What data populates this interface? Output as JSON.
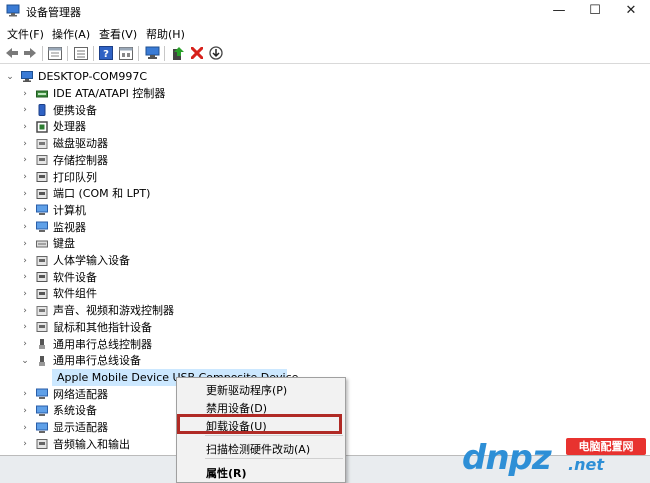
{
  "window": {
    "title": "设备管理器",
    "minimize_glyph": "—",
    "maximize_glyph": "☐",
    "close_glyph": "✕"
  },
  "menu": [
    {
      "label": "文件(F)"
    },
    {
      "label": "操作(A)"
    },
    {
      "label": "查看(V)"
    },
    {
      "label": "帮助(H)"
    }
  ],
  "toolbar": {
    "buttons": [
      {
        "icon": "back-arrow-icon"
      },
      {
        "icon": "forward-arrow-icon"
      },
      {
        "icon": "properties-icon"
      },
      {
        "icon": "list-view-icon"
      },
      {
        "icon": "help-icon"
      },
      {
        "icon": "resources-view-icon"
      },
      {
        "icon": "scan-hardware-icon"
      },
      {
        "icon": "update-driver-icon"
      },
      {
        "icon": "uninstall-icon"
      },
      {
        "icon": "download-arrow-icon"
      }
    ],
    "colors": {
      "uninstall": "#d7211b",
      "help": "#2f62c4",
      "update": "#2aa02a"
    }
  },
  "tree": {
    "root": {
      "label": "DESKTOP-COM997C",
      "expanded": true
    },
    "items": [
      {
        "label": "IDE ATA/ATAPI 控制器",
        "icon": "ide-controller-icon",
        "expanded": false
      },
      {
        "label": "便携设备",
        "icon": "portable-device-icon",
        "expanded": false
      },
      {
        "label": "处理器",
        "icon": "processor-icon",
        "expanded": false
      },
      {
        "label": "磁盘驱动器",
        "icon": "disk-drive-icon",
        "expanded": false
      },
      {
        "label": "存储控制器",
        "icon": "storage-controller-icon",
        "expanded": false
      },
      {
        "label": "打印队列",
        "icon": "printer-icon",
        "expanded": false
      },
      {
        "label": "端口 (COM 和 LPT)",
        "icon": "port-icon",
        "expanded": false
      },
      {
        "label": "计算机",
        "icon": "computer-icon",
        "expanded": false
      },
      {
        "label": "监视器",
        "icon": "monitor-icon",
        "expanded": false
      },
      {
        "label": "键盘",
        "icon": "keyboard-icon",
        "expanded": false
      },
      {
        "label": "人体学输入设备",
        "icon": "hid-icon",
        "expanded": false
      },
      {
        "label": "软件设备",
        "icon": "software-device-icon",
        "expanded": false
      },
      {
        "label": "软件组件",
        "icon": "software-component-icon",
        "expanded": false
      },
      {
        "label": "声音、视频和游戏控制器",
        "icon": "sound-icon",
        "expanded": false
      },
      {
        "label": "鼠标和其他指针设备",
        "icon": "mouse-icon",
        "expanded": false
      },
      {
        "label": "通用串行总线控制器",
        "icon": "usb-icon",
        "expanded": false
      },
      {
        "label": "通用串行总线设备",
        "icon": "usb-icon",
        "expanded": true
      },
      {
        "label": "Apple Mobile Device USB Composite Device",
        "icon": "usb-device-icon",
        "child": true,
        "selected": true
      },
      {
        "label": "网络适配器",
        "icon": "network-adapter-icon",
        "expanded": false
      },
      {
        "label": "系统设备",
        "icon": "system-device-icon",
        "expanded": false
      },
      {
        "label": "显示适配器",
        "icon": "display-adapter-icon",
        "expanded": false
      },
      {
        "label": "音频输入和输出",
        "icon": "audio-io-icon",
        "expanded": false
      }
    ]
  },
  "context_menu": {
    "items": [
      {
        "label": "更新驱动程序(P)"
      },
      {
        "label": "禁用设备(D)"
      },
      {
        "label": "卸载设备(U)",
        "highlighted": true
      },
      {
        "label": "扫描检测硬件改动(A)"
      },
      {
        "label": "属性(R)",
        "bold": true
      }
    ],
    "highlight_color": "#b02a25"
  },
  "watermark": {
    "brand": "dnpz",
    "badge": "电脑配置网",
    "domain": ".net"
  }
}
